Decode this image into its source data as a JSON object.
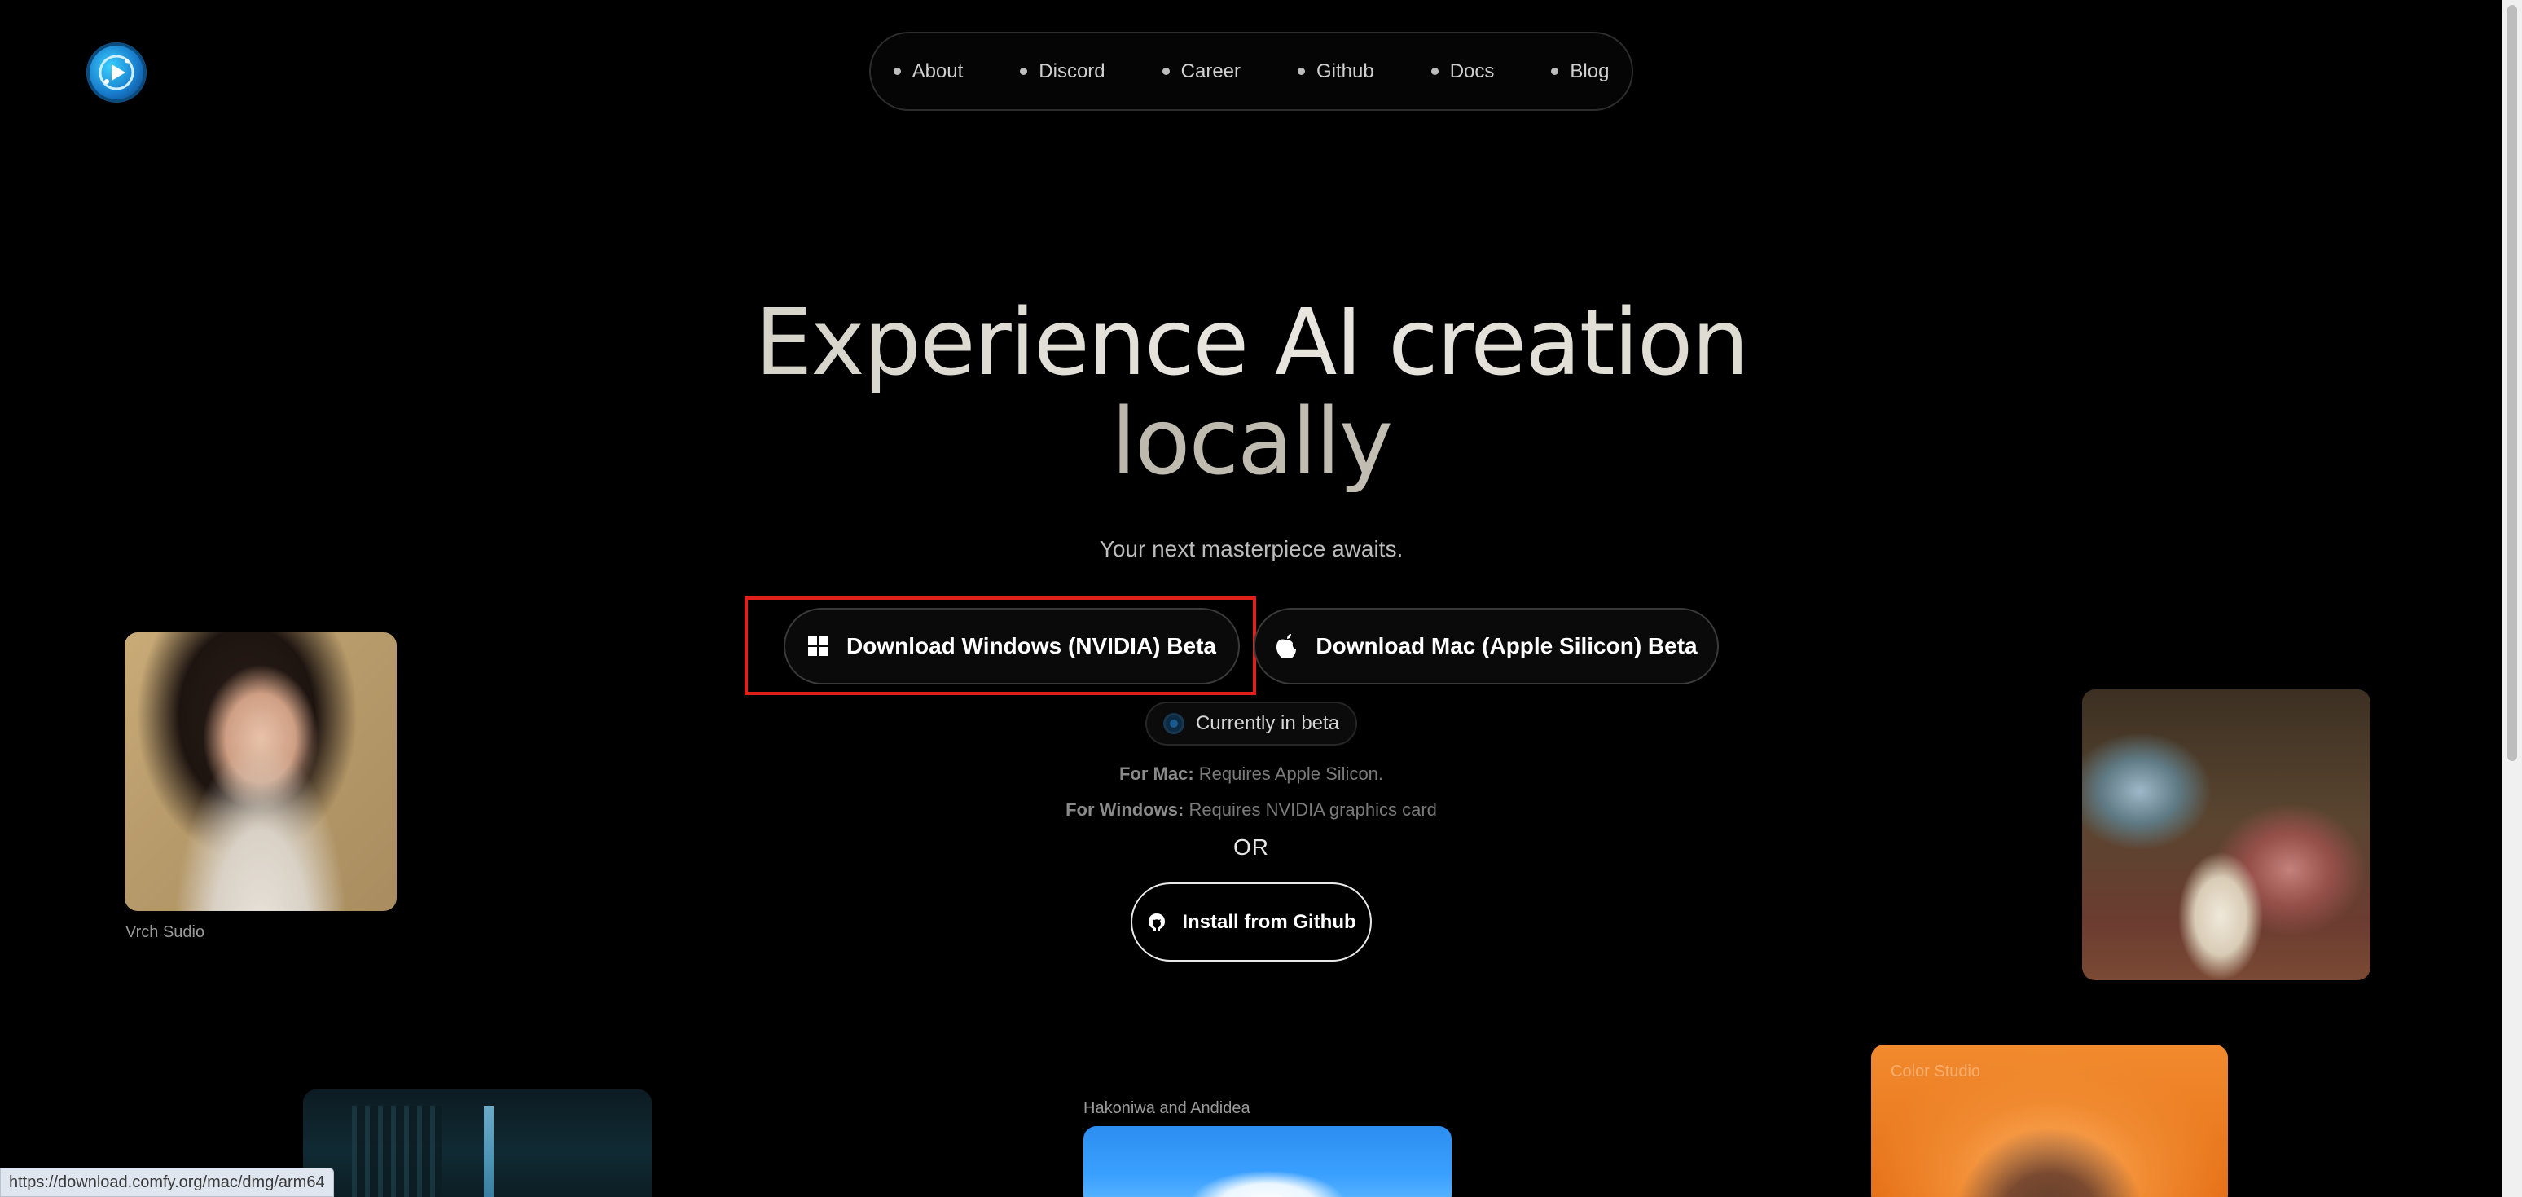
{
  "nav": {
    "items": [
      {
        "label": "About"
      },
      {
        "label": "Discord"
      },
      {
        "label": "Career"
      },
      {
        "label": "Github"
      },
      {
        "label": "Docs"
      },
      {
        "label": "Blog"
      }
    ]
  },
  "hero": {
    "title_line1": "Experience AI creation",
    "title_line2": "locally",
    "subtitle": "Your next masterpiece awaits."
  },
  "downloads": {
    "windows_label": "Download Windows (NVIDIA) Beta",
    "mac_label": "Download Mac (Apple Silicon) Beta",
    "beta_status": "Currently in beta",
    "mac_req_prefix": "For Mac:",
    "mac_req_text": "Requires Apple Silicon.",
    "win_req_prefix": "For Windows:",
    "win_req_text": "Requires NVIDIA graphics card",
    "or_text": "OR",
    "github_label": "Install from Github"
  },
  "gallery": {
    "caption_left": "Vrch Sudio",
    "caption_center": "Hakoniwa and Andidea",
    "caption_orange": "Color Studio"
  },
  "status_bar": {
    "url": "https://download.comfy.org/mac/dmg/arm64"
  },
  "icons": {
    "logo": "comfy-logo-icon",
    "windows": "windows-icon",
    "apple": "apple-icon",
    "github": "github-icon"
  },
  "colors": {
    "background": "#000000",
    "highlight_box": "#e0201b",
    "button_border": "#3a3a3a"
  }
}
